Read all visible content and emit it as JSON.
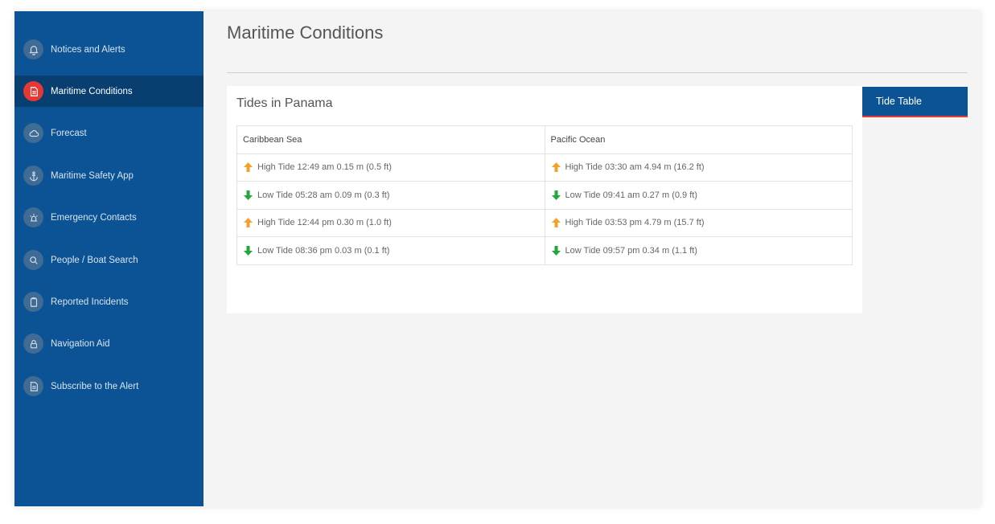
{
  "sidebar": {
    "items": [
      {
        "label": "Notices and Alerts",
        "icon": "bell-icon",
        "active": false
      },
      {
        "label": "Maritime Conditions",
        "icon": "document-icon",
        "active": true
      },
      {
        "label": "Forecast",
        "icon": "cloud-icon",
        "active": false
      },
      {
        "label": "Maritime Safety App",
        "icon": "anchor-icon",
        "active": false
      },
      {
        "label": "Emergency Contacts",
        "icon": "siren-icon",
        "active": false
      },
      {
        "label": "People / Boat Search",
        "icon": "search-icon",
        "active": false
      },
      {
        "label": "Reported Incidents",
        "icon": "clipboard-icon",
        "active": false
      },
      {
        "label": "Navigation Aid",
        "icon": "lock-icon",
        "active": false
      },
      {
        "label": "Subscribe to the Alert",
        "icon": "document-icon",
        "active": false
      }
    ]
  },
  "main": {
    "title": "Maritime Conditions",
    "card_title": "Tides in Panama",
    "tab_label": "Tide Table"
  },
  "tides": {
    "columns": [
      "Caribbean Sea",
      "Pacific Ocean"
    ],
    "rows": [
      [
        {
          "type": "high",
          "text": "High Tide 12:49 am 0.15 m (0.5 ft)"
        },
        {
          "type": "high",
          "text": "High Tide 03:30 am 4.94 m (16.2 ft)"
        }
      ],
      [
        {
          "type": "low",
          "text": "Low Tide 05:28 am 0.09 m (0.3 ft)"
        },
        {
          "type": "low",
          "text": "Low Tide 09:41 am 0.27 m (0.9 ft)"
        }
      ],
      [
        {
          "type": "high",
          "text": "High Tide 12:44 pm 0.30 m (1.0 ft)"
        },
        {
          "type": "high",
          "text": "High Tide 03:53 pm 4.79 m (15.7 ft)"
        }
      ],
      [
        {
          "type": "low",
          "text": "Low Tide 08:36 pm 0.03 m (0.1 ft)"
        },
        {
          "type": "low",
          "text": "Low Tide 09:57 pm 0.34 m (1.1 ft)"
        }
      ]
    ]
  },
  "colors": {
    "sidebar": "#0b5394",
    "sidebar_active": "#083e70",
    "accent": "#e53935",
    "high_tide": "#f5a02a",
    "low_tide": "#22a83a"
  }
}
